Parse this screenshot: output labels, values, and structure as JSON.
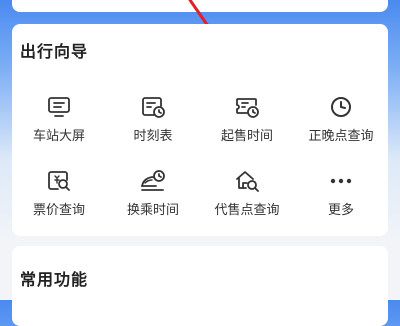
{
  "guide": {
    "title": "出行向导",
    "items": [
      {
        "label": "车站大屏",
        "icon": "station-screen-icon"
      },
      {
        "label": "时刻表",
        "icon": "timetable-icon"
      },
      {
        "label": "起售时间",
        "icon": "ticket-sale-time-icon"
      },
      {
        "label": "正晚点查询",
        "icon": "clock-icon"
      },
      {
        "label": "票价查询",
        "icon": "fare-search-icon"
      },
      {
        "label": "换乘时间",
        "icon": "transfer-time-icon"
      },
      {
        "label": "代售点查询",
        "icon": "agency-search-icon"
      },
      {
        "label": "更多",
        "icon": "more-dots-icon"
      }
    ]
  },
  "common": {
    "title": "常用功能"
  },
  "colors": {
    "accent": "#4a8af0",
    "icon": "#333333",
    "annotation_arrow": "#e0202a"
  }
}
